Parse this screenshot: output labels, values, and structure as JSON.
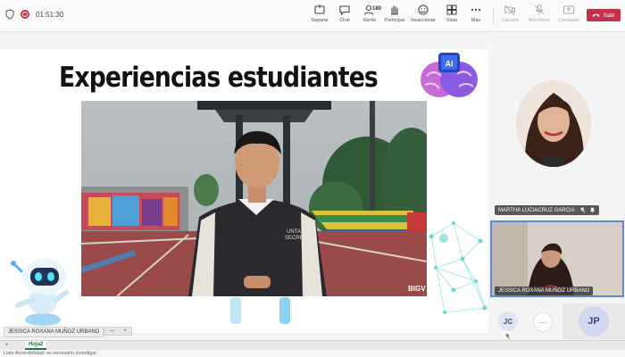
{
  "meeting": {
    "timer": "01:51:30"
  },
  "toolbar": {
    "buttons": [
      {
        "label": "Separar",
        "icon": "separate-icon"
      },
      {
        "label": "Chat",
        "icon": "chat-icon"
      },
      {
        "label": "Gente",
        "icon": "people-icon",
        "count": "180"
      },
      {
        "label": "Participar",
        "icon": "raise-hand-icon"
      },
      {
        "label": "Reaccionar",
        "icon": "react-icon"
      },
      {
        "label": "Vista",
        "icon": "view-icon"
      },
      {
        "label": "Más",
        "icon": "more-icon"
      },
      {
        "label": "Cámara",
        "icon": "camera-off-icon"
      },
      {
        "label": "Micrófono",
        "icon": "mic-off-icon"
      },
      {
        "label": "Compartir",
        "icon": "share-icon"
      }
    ],
    "leave_label": "Salir"
  },
  "slide": {
    "title": "Experiencias estudiantes",
    "ai_badge": "AI",
    "video_watermark": "BIGV",
    "shirt_text": [
      "UNTA",
      "SECRE"
    ]
  },
  "gallery": {
    "pinned_name": "MARTHA LUCIACRUZ GARCIA",
    "tile_name": "JESSICA ROXANA MUÑOZ URBANO",
    "participant_initials": [
      "JC",
      "JP"
    ],
    "more_symbol": "···"
  },
  "presenter_chip": "JESSICA ROXANA MUÑOZ URBANO",
  "zoom_chip": {
    "minus": "—",
    "plus": "+"
  },
  "excel": {
    "sheet_tab": "Hoja2",
    "add_sheet": "+",
    "status": "Listo   Accesibilidad: es necesario investigar"
  },
  "colors": {
    "accent": "#5b8bd6",
    "leave": "#c4314b",
    "sheet_green": "#1e7145"
  }
}
